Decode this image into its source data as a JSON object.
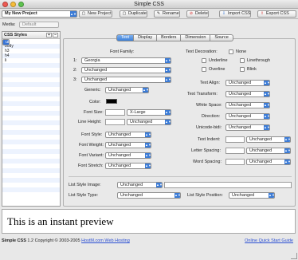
{
  "window": {
    "title": "Simple CSS",
    "colors": {
      "close": "#ee5a52",
      "minimize": "#f7bd3a",
      "zoom": "#5fc34f",
      "accent": "#3b7bd6"
    }
  },
  "toolbar": {
    "project_value": "My New Project",
    "buttons": {
      "new_project": "New Project",
      "duplicate": "Duplicate",
      "rename": "Rename",
      "delete": "Delete",
      "import_css": "Import CSS",
      "export_css": "Export CSS"
    }
  },
  "sidebar": {
    "media_label": "Media:",
    "media_value": "Default",
    "styles_title": "CSS Styles",
    "add": "+",
    "remove": "–",
    "items": [
      "ul",
      "p",
      "body",
      "h3",
      "h4",
      "li"
    ]
  },
  "tabs": [
    "Text",
    "Display",
    "Borders",
    "Dimension",
    "Source"
  ],
  "text_tab": {
    "font_family_label": "Font Family:",
    "font_rows": [
      {
        "num": "1:",
        "value": "Georgia"
      },
      {
        "num": "2:",
        "value": "Unchanged"
      },
      {
        "num": "3:",
        "value": "Unchanged"
      }
    ],
    "generic": {
      "label": "Generic:",
      "value": "Unchanged"
    },
    "color": {
      "label": "Color:"
    },
    "font_size": {
      "label": "Font Size:",
      "value": "X-Large"
    },
    "line_height": {
      "label": "Line Height:",
      "value": "Unchanged"
    },
    "font_style": {
      "label": "Font Style:",
      "value": "Unchanged"
    },
    "font_weight": {
      "label": "Font Weight:",
      "value": "Unchanged"
    },
    "font_variant": {
      "label": "Font Variant:",
      "value": "Unchanged"
    },
    "font_stretch": {
      "label": "Font Stretch:",
      "value": "Unchanged"
    },
    "decoration": {
      "label": "Text Decoration:",
      "none": "None",
      "underline": "Underline",
      "linethrough": "Linethrough",
      "overline": "Overline",
      "blink": "Blink"
    },
    "text_align": {
      "label": "Text Align:",
      "value": "Unchanged"
    },
    "text_transform": {
      "label": "Text Transform:",
      "value": "Unchanged"
    },
    "white_space": {
      "label": "White Space:",
      "value": "Unchanged"
    },
    "direction": {
      "label": "Direction:",
      "value": "Unchanged"
    },
    "unicode_bidi": {
      "label": "Unicode-bidi:",
      "value": "Unchanged"
    },
    "text_indent": {
      "label": "Text Indent:",
      "value": "Unchanged"
    },
    "letter_spacing": {
      "label": "Letter Spacing:",
      "value": "Unchanged"
    },
    "word_spacing": {
      "label": "Word Spacing:",
      "value": "Unchanged"
    },
    "list_style_image": {
      "label": "List Style Image:",
      "value": "Unchanged"
    },
    "list_style_type": {
      "label": "List Style Type:",
      "value": "Unchanged"
    },
    "list_style_position": {
      "label": "List Style Position:",
      "value": "Unchanged"
    }
  },
  "preview": {
    "text": "This is an instant preview"
  },
  "footer": {
    "app": "Simple CSS",
    "copyright": " 1.2 Copyright © 2003-2005 ",
    "host_link": "HostM.com Web Hosting",
    "guide_link": "Online Quick Start Guide"
  }
}
